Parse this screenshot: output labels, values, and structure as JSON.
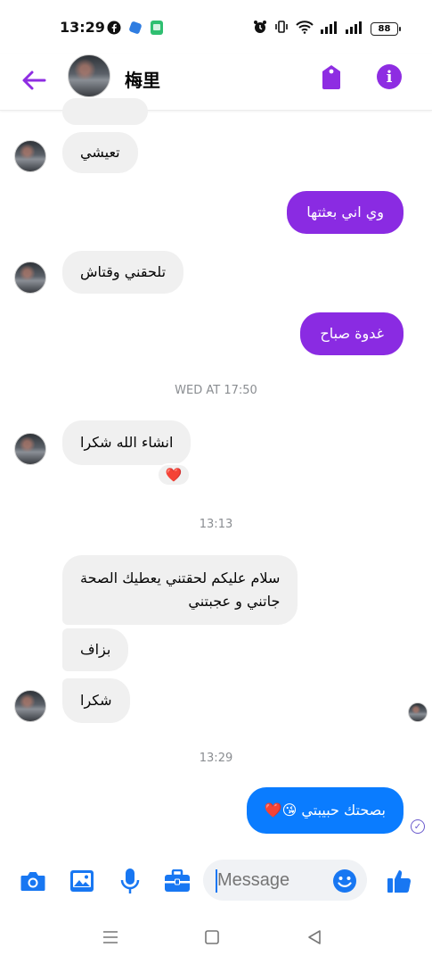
{
  "status_bar": {
    "time": "13:29",
    "battery": "88",
    "left_icons": [
      "facebook-icon",
      "app-icon",
      "app-green-icon"
    ],
    "right_icons": [
      "alarm-icon",
      "vibrate-icon",
      "wifi-icon",
      "signal-icon",
      "signal-icon",
      "battery-icon"
    ]
  },
  "header": {
    "contact_name": "梅里",
    "accent_color": "#8e2de2"
  },
  "messages": [
    {
      "id": "m1",
      "direction": "incoming",
      "text": "تعيشي"
    },
    {
      "id": "m2",
      "direction": "outgoing",
      "text": "وي اني بعثتها"
    },
    {
      "id": "m3",
      "direction": "incoming",
      "text": "تلحقني وقتاش"
    },
    {
      "id": "m4",
      "direction": "outgoing",
      "text": "غدوة صباح"
    },
    {
      "id": "m5",
      "direction": "incoming",
      "text": "انشاء الله شكرا",
      "reaction": "❤️"
    },
    {
      "id": "m6",
      "direction": "incoming",
      "lines": [
        "سلام عليكم لحقتني يعطيك الصحة",
        "جاتني و عجبتني"
      ]
    },
    {
      "id": "m7",
      "direction": "incoming",
      "text": "بزاف"
    },
    {
      "id": "m8",
      "direction": "incoming",
      "text": "شكرا"
    },
    {
      "id": "m9",
      "direction": "outgoing",
      "text": "بصحتك حبيبتي 😘❤️"
    }
  ],
  "timestamps": [
    "WED AT 17:50",
    "13:13",
    "13:29"
  ],
  "composer": {
    "placeholder": "Message",
    "icons": [
      "camera-icon",
      "image-icon",
      "microphone-icon",
      "briefcase-icon",
      "emoji-icon",
      "thumbs-up-icon"
    ]
  },
  "colors": {
    "outgoing_purple": "#8a2be2",
    "outgoing_blue": "#0a7cff",
    "incoming_bg": "#f0f0f0",
    "icon_blue": "#1877f2"
  }
}
